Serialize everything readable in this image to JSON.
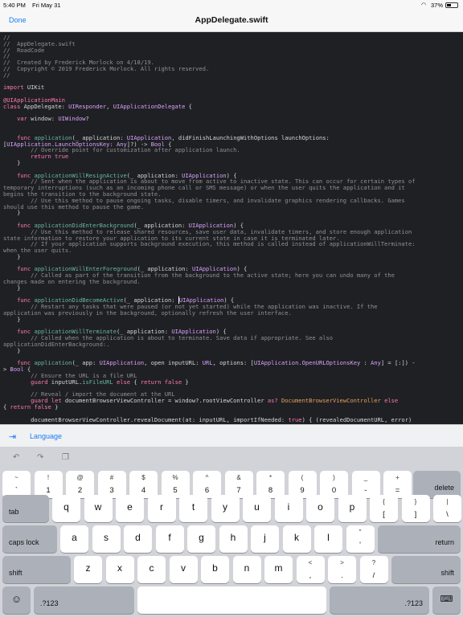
{
  "status": {
    "time": "5:40 PM",
    "date": "Fri May 31",
    "battery": "37%"
  },
  "nav": {
    "done": "Done",
    "title": "AppDelegate.swift"
  },
  "language_bar": {
    "label": "Language"
  },
  "keyboard": {
    "row1": [
      [
        "~",
        "`"
      ],
      [
        "!",
        "1"
      ],
      [
        "@",
        "2"
      ],
      [
        "#",
        "3"
      ],
      [
        "$",
        "4"
      ],
      [
        "%",
        "5"
      ],
      [
        "^",
        "6"
      ],
      [
        "&",
        "7"
      ],
      [
        "*",
        "8"
      ],
      [
        "(",
        "9"
      ],
      [
        ")",
        "0"
      ],
      [
        "_",
        "-"
      ],
      [
        "+",
        "="
      ]
    ],
    "row1_delete": "delete",
    "row2_tab": "tab",
    "row2": [
      "q",
      "w",
      "e",
      "r",
      "t",
      "y",
      "u",
      "i",
      "o",
      "p"
    ],
    "row2_sym": [
      [
        "{",
        "["
      ],
      [
        "}",
        "]"
      ],
      [
        "|",
        "\\"
      ]
    ],
    "row3_caps": "caps lock",
    "row3": [
      "a",
      "s",
      "d",
      "f",
      "g",
      "h",
      "j",
      "k",
      "l"
    ],
    "row3_sym": [
      [
        "\"",
        "'"
      ]
    ],
    "row3_return": "return",
    "row4_shift_left": "shift",
    "row4": [
      "z",
      "x",
      "c",
      "v",
      "b",
      "n",
      "m"
    ],
    "row4_sym": [
      [
        "<",
        ","
      ],
      [
        ">",
        "."
      ],
      [
        "?",
        "/"
      ]
    ],
    "row4_shift_right": "shift",
    "row5_numleft": ".?123",
    "row5_numright": ".?123"
  }
}
